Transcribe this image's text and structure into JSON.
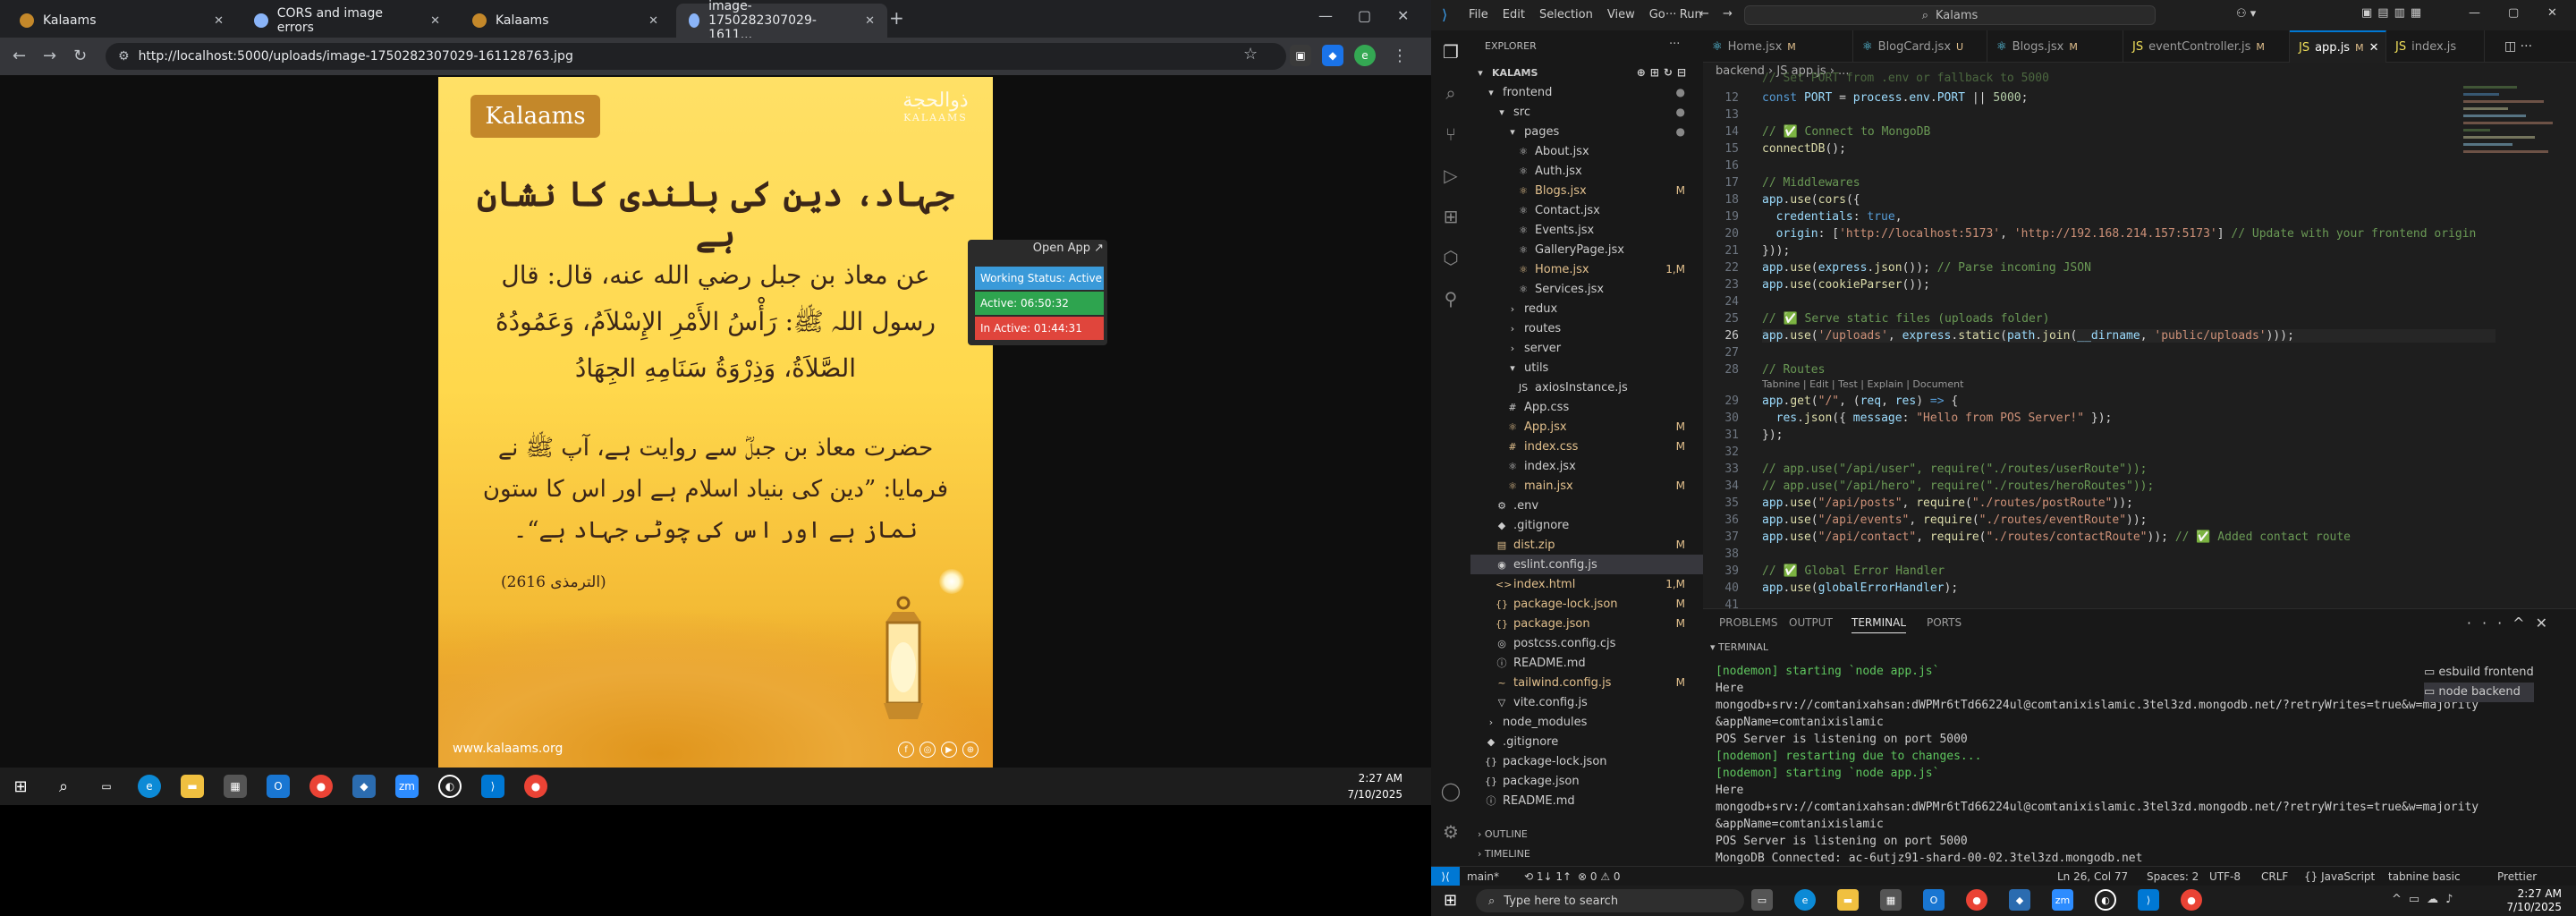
{
  "chrome": {
    "tabs": [
      {
        "label": "Kalaams",
        "color": "#c4882a"
      },
      {
        "label": "CORS and image errors",
        "color": "#8ab4f8"
      },
      {
        "label": "Kalaams",
        "color": "#c4882a"
      },
      {
        "label": "image-1750282307029-1611...",
        "color": "#8ab4f8"
      }
    ],
    "url": "http://localhost:5000/uploads/image-1750282307029-161128763.jpg"
  },
  "poster": {
    "logo": "Kalaams",
    "calligraphy": "ذوالحجة",
    "calligraphy_sub": "KALAAMS",
    "title": "جہاد، دین کی بلندی کا نشان ہے",
    "arabic": [
      "عن معاذ بن جبل رضي الله عنه، قال: قال",
      "رسول اللہ ﷺ: رَأْسُ الأَمْرِ الإِسْلاَمُ، وَعَمُودُهُ",
      "الصَّلاَةُ، وَذِرْوَةُ سَنَامِهِ الجِهَادُ"
    ],
    "urdu": [
      "حضرت معاذ بن جبلؓ سے روایت ہے، آپ ﷺ نے",
      "فرمایا: ”دین کی بنیاد اسلام ہے اور اس کا ستون",
      "نماز ہے اور اس کی چوٹی جہاد ہے“۔"
    ],
    "ref": "(الترمذی 2616)",
    "site": "www.kalaams.org"
  },
  "widget": {
    "open": "Open App ↗",
    "working": "Working Status: Active",
    "active": "Active: 06:50:32",
    "inactive": "In Active: 01:44:31"
  },
  "taskbar1": {
    "time": "2:27 AM",
    "date": "7/10/2025"
  },
  "vscode": {
    "menu": [
      "File",
      "Edit",
      "Selection",
      "View",
      "Go",
      "Run"
    ],
    "menu_more": "···",
    "command": "Kalams",
    "explorer_title": "EXPLORER",
    "project": "KALAMS",
    "tree": [
      {
        "name": "frontend",
        "icon": "▾",
        "indent": 1,
        "mark": "●",
        "markColor": "#888"
      },
      {
        "name": "src",
        "icon": "▾",
        "indent": 2,
        "mark": "●",
        "markColor": "#888"
      },
      {
        "name": "pages",
        "icon": "▾",
        "indent": 3,
        "mark": "●",
        "markColor": "#888"
      },
      {
        "name": "About.jsx",
        "icon": "⚛",
        "indent": 4,
        "mark": "",
        "markColor": "#61dafb"
      },
      {
        "name": "Auth.jsx",
        "icon": "⚛",
        "indent": 4,
        "mark": "",
        "markColor": ""
      },
      {
        "name": "Blogs.jsx",
        "icon": "⚛",
        "indent": 4,
        "mark": "M",
        "markColor": "#e2c08d"
      },
      {
        "name": "Contact.jsx",
        "icon": "⚛",
        "indent": 4,
        "mark": "",
        "markColor": ""
      },
      {
        "name": "Events.jsx",
        "icon": "⚛",
        "indent": 4,
        "mark": "",
        "markColor": ""
      },
      {
        "name": "GalleryPage.jsx",
        "icon": "⚛",
        "indent": 4,
        "mark": "",
        "markColor": ""
      },
      {
        "name": "Home.jsx",
        "icon": "⚛",
        "indent": 4,
        "mark": "1,M",
        "markColor": "#e2c08d"
      },
      {
        "name": "Services.jsx",
        "icon": "⚛",
        "indent": 4,
        "mark": "",
        "markColor": ""
      },
      {
        "name": "redux",
        "icon": "›",
        "indent": 3,
        "mark": "",
        "markColor": ""
      },
      {
        "name": "routes",
        "icon": "›",
        "indent": 3,
        "mark": "",
        "markColor": ""
      },
      {
        "name": "server",
        "icon": "›",
        "indent": 3,
        "mark": "",
        "markColor": ""
      },
      {
        "name": "utils",
        "icon": "▾",
        "indent": 3,
        "mark": "",
        "markColor": ""
      },
      {
        "name": "axiosInstance.js",
        "icon": "JS",
        "indent": 4,
        "mark": "",
        "markColor": ""
      },
      {
        "name": "App.css",
        "icon": "#",
        "indent": 3,
        "mark": "",
        "markColor": ""
      },
      {
        "name": "App.jsx",
        "icon": "⚛",
        "indent": 3,
        "mark": "M",
        "markColor": "#e2c08d"
      },
      {
        "name": "index.css",
        "icon": "#",
        "indent": 3,
        "mark": "M",
        "markColor": "#e2c08d"
      },
      {
        "name": "index.jsx",
        "icon": "⚛",
        "indent": 3,
        "mark": "",
        "markColor": ""
      },
      {
        "name": "main.jsx",
        "icon": "⚛",
        "indent": 3,
        "mark": "M",
        "markColor": "#e2c08d"
      },
      {
        "name": ".env",
        "icon": "⚙",
        "indent": 2,
        "mark": "",
        "markColor": ""
      },
      {
        "name": ".gitignore",
        "icon": "◆",
        "indent": 2,
        "mark": "",
        "markColor": ""
      },
      {
        "name": "dist.zip",
        "icon": "▤",
        "indent": 2,
        "mark": "M",
        "markColor": "#e2c08d"
      },
      {
        "name": "eslint.config.js",
        "icon": "◉",
        "indent": 2,
        "mark": "",
        "markColor": ""
      },
      {
        "name": "index.html",
        "icon": "<>",
        "indent": 2,
        "mark": "1,M",
        "markColor": "#e2c08d"
      },
      {
        "name": "package-lock.json",
        "icon": "{}",
        "indent": 2,
        "mark": "M",
        "markColor": "#e2c08d"
      },
      {
        "name": "package.json",
        "icon": "{}",
        "indent": 2,
        "mark": "M",
        "markColor": "#e2c08d"
      },
      {
        "name": "postcss.config.cjs",
        "icon": "◎",
        "indent": 2,
        "mark": "",
        "markColor": ""
      },
      {
        "name": "README.md",
        "icon": "ⓘ",
        "indent": 2,
        "mark": "",
        "markColor": ""
      },
      {
        "name": "tailwind.config.js",
        "icon": "~",
        "indent": 2,
        "mark": "M",
        "markColor": "#e2c08d"
      },
      {
        "name": "vite.config.js",
        "icon": "▽",
        "indent": 2,
        "mark": "",
        "markColor": ""
      },
      {
        "name": "node_modules",
        "icon": "›",
        "indent": 1,
        "mark": "",
        "markColor": ""
      },
      {
        "name": ".gitignore",
        "icon": "◆",
        "indent": 1,
        "mark": "",
        "markColor": ""
      },
      {
        "name": "package-lock.json",
        "icon": "{}",
        "indent": 1,
        "mark": "",
        "markColor": ""
      },
      {
        "name": "package.json",
        "icon": "{}",
        "indent": 1,
        "mark": "",
        "markColor": ""
      },
      {
        "name": "README.md",
        "icon": "ⓘ",
        "indent": 1,
        "mark": "",
        "markColor": ""
      }
    ],
    "outline": "OUTLINE",
    "timeline": "TIMELINE",
    "tabs": [
      {
        "label": "Home.jsx",
        "mark": "M"
      },
      {
        "label": "BlogCard.jsx",
        "mark": "U"
      },
      {
        "label": "Blogs.jsx",
        "mark": "M"
      },
      {
        "label": "eventController.js",
        "mark": "M"
      },
      {
        "label": "app.js",
        "mark": "M"
      },
      {
        "label": "index.js",
        "mark": ""
      }
    ],
    "breadcrumb": "backend › JS app.js › ...",
    "lines": [
      {
        "n": "12",
        "html": "<span class='k'>const</span> <span class='v'>PORT</span> = <span class='v'>process</span>.<span class='v'>env</span>.<span class='v'>PORT</span> || <span class='n'>5000</span>;"
      },
      {
        "n": "13",
        "html": ""
      },
      {
        "n": "14",
        "html": "<span class='c'>// ✅ Connect to MongoDB</span>"
      },
      {
        "n": "15",
        "html": "<span class='f'>connectDB</span>();"
      },
      {
        "n": "16",
        "html": ""
      },
      {
        "n": "17",
        "html": "<span class='c'>// Middlewares</span>"
      },
      {
        "n": "18",
        "html": "<span class='v'>app</span>.<span class='f'>use</span>(<span class='f'>cors</span>({"
      },
      {
        "n": "19",
        "html": "  <span class='v'>credentials</span>: <span class='k'>true</span>,"
      },
      {
        "n": "20",
        "html": "  <span class='v'>origin</span>: [<span class='s'>'http://localhost:5173'</span>, <span class='s'>'http://192.168.214.157:5173'</span>] <span class='c'>// Update with your frontend origin</span>"
      },
      {
        "n": "21",
        "html": "}));"
      },
      {
        "n": "22",
        "html": "<span class='v'>app</span>.<span class='f'>use</span>(<span class='v'>express</span>.<span class='f'>json</span>()); <span class='c'>// Parse incoming JSON</span>"
      },
      {
        "n": "23",
        "html": "<span class='v'>app</span>.<span class='f'>use</span>(<span class='f'>cookieParser</span>());"
      },
      {
        "n": "24",
        "html": ""
      },
      {
        "n": "25",
        "html": "<span class='c'>// ✅ Serve static files (uploads folder)</span>"
      },
      {
        "n": "26",
        "html": "<span class='v'>app</span>.<span class='f'>use</span>(<span class='s'>'/uploads'</span>, <span class='v'>express</span>.<span class='f'>static</span>(<span class='v'>path</span>.<span class='f'>join</span>(<span class='v'>__dirname</span>, <span class='s'>'public/uploads'</span>)));"
      },
      {
        "n": "27",
        "html": ""
      },
      {
        "n": "28",
        "html": "<span class='c'>// Routes</span>"
      },
      {
        "n": "29",
        "html": "<span class='v'>app</span>.<span class='f'>get</span>(<span class='s'>\"/\"</span>, (<span class='v'>req</span>, <span class='v'>res</span>) <span class='k'>=&gt;</span> {"
      },
      {
        "n": "30",
        "html": "  <span class='v'>res</span>.<span class='f'>json</span>({ <span class='v'>message</span>: <span class='s'>\"Hello from POS Server!\"</span> });"
      },
      {
        "n": "31",
        "html": "});"
      },
      {
        "n": "32",
        "html": ""
      },
      {
        "n": "33",
        "html": "<span class='c'>// app.use(\"/api/user\", require(\"./routes/userRoute\"));</span>"
      },
      {
        "n": "34",
        "html": "<span class='c'>// app.use(\"/api/hero\", require(\"./routes/heroRoutes\"));</span>"
      },
      {
        "n": "35",
        "html": "<span class='v'>app</span>.<span class='f'>use</span>(<span class='s'>\"/api/posts\"</span>, <span class='f'>require</span>(<span class='s'>\"./routes/postRoute\"</span>));"
      },
      {
        "n": "36",
        "html": "<span class='v'>app</span>.<span class='f'>use</span>(<span class='s'>\"/api/events\"</span>, <span class='f'>require</span>(<span class='s'>\"./routes/eventRoute\"</span>));"
      },
      {
        "n": "37",
        "html": "<span class='v'>app</span>.<span class='f'>use</span>(<span class='s'>\"/api/contact\"</span>, <span class='f'>require</span>(<span class='s'>\"./routes/contactRoute\"</span>)); <span class='c'>// ✅ Added contact route</span>"
      },
      {
        "n": "38",
        "html": ""
      },
      {
        "n": "39",
        "html": "<span class='c'>// ✅ Global Error Handler</span>"
      },
      {
        "n": "40",
        "html": "<span class='v'>app</span>.<span class='f'>use</span>(<span class='v'>globalErrorHandler</span>);"
      },
      {
        "n": "41",
        "html": ""
      }
    ],
    "codelens": "Tabnine | Edit | Test | Explain | Document",
    "panel_tabs": [
      "PROBLEMS",
      "OUTPUT",
      "TERMINAL",
      "PORTS"
    ],
    "terminal_title": "TERMINAL",
    "terminal": [
      {
        "t": "[nodemon] starting `node app.js`",
        "g": true
      },
      {
        "t": "Here",
        "g": false
      },
      {
        "t": "mongodb+srv://comtanixahsan:dWPMr6tTd66224ul@comtanixislamic.3tel3zd.mongodb.net/?retryWrites=true&w=majority",
        "g": false
      },
      {
        "t": "&appName=comtanixislamic",
        "g": false
      },
      {
        "t": "POS Server is listening on port 5000",
        "g": false
      },
      {
        "t": "[nodemon] restarting due to changes...",
        "g": true
      },
      {
        "t": "[nodemon] starting `node app.js`",
        "g": true
      },
      {
        "t": "Here",
        "g": false
      },
      {
        "t": "mongodb+srv://comtanixahsan:dWPMr6tTd66224ul@comtanixislamic.3tel3zd.mongodb.net/?retryWrites=true&w=majority",
        "g": false
      },
      {
        "t": "&appName=comtanixislamic",
        "g": false
      },
      {
        "t": "POS Server is listening on port 5000",
        "g": false
      },
      {
        "t": "MongoDB Connected: ac-6utjz91-shard-00-02.3tel3zd.mongodb.net",
        "g": false
      },
      {
        "t": "▯",
        "g": false
      }
    ],
    "sessions": [
      "esbuild  frontend",
      "node  backend"
    ],
    "status_left": [
      "main*",
      "⟲ 1↓ 1↑",
      "⊗ 0 ⚠ 0"
    ],
    "status_right": [
      "Ln 26, Col 77",
      "Spaces: 2",
      "UTF-8",
      "CRLF",
      "{} JavaScript",
      "tabnine basic",
      "Prettier"
    ]
  },
  "taskbar2": {
    "search": "Type here to search",
    "time": "2:27 AM",
    "date": "7/10/2025"
  }
}
